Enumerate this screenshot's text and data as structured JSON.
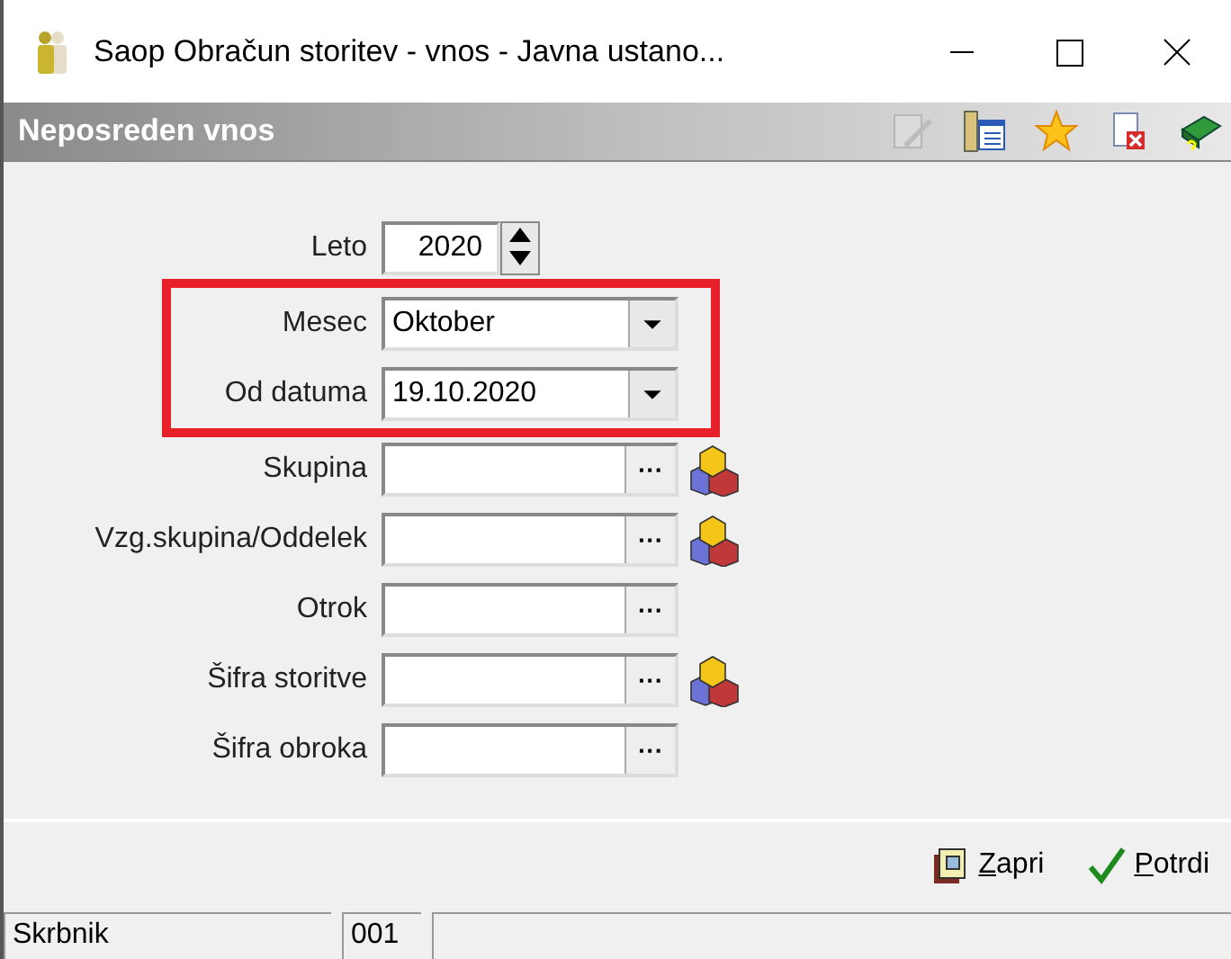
{
  "window": {
    "title": "Saop Obračun storitev - vnos - Javna ustano..."
  },
  "header": {
    "title": "Neposreden vnos",
    "toolbar": [
      {
        "kind": "edit",
        "disabled": true
      },
      {
        "kind": "columns",
        "disabled": false
      },
      {
        "kind": "star",
        "disabled": false
      },
      {
        "kind": "delete",
        "disabled": false
      },
      {
        "kind": "help",
        "disabled": false
      }
    ]
  },
  "form": {
    "fields": [
      {
        "label": "Leto",
        "kind": "spinner",
        "value": "2020",
        "highlighted": false
      },
      {
        "label": "Mesec",
        "kind": "combo",
        "value": "Oktober",
        "highlighted": true
      },
      {
        "label": "Od datuma",
        "kind": "combo",
        "value": "19.10.2020",
        "highlighted": true
      },
      {
        "label": "Skupina",
        "kind": "lookup",
        "button": "···",
        "highlighted": false,
        "cube_icon": true
      },
      {
        "label": "Vzg.skupina/Oddelek",
        "kind": "lookup",
        "button": "···",
        "highlighted": false,
        "cube_icon": true
      },
      {
        "label": "Otrok",
        "kind": "lookup",
        "button": "···",
        "highlighted": false,
        "cube_icon": false
      },
      {
        "label": "Šifra storitve",
        "kind": "lookup",
        "button": "···",
        "highlighted": false,
        "cube_icon": true
      },
      {
        "label": "Šifra obroka",
        "kind": "lookup",
        "button": "···",
        "highlighted": false,
        "cube_icon": false
      }
    ]
  },
  "buttons": [
    {
      "kind": "close",
      "label": "Zapri",
      "accelerator_underlined": true
    },
    {
      "kind": "confirm",
      "label": "Potrdi",
      "accelerator_underlined": true
    }
  ],
  "status_bar": {
    "cells": [
      "Skrbnik",
      "001",
      ""
    ]
  }
}
